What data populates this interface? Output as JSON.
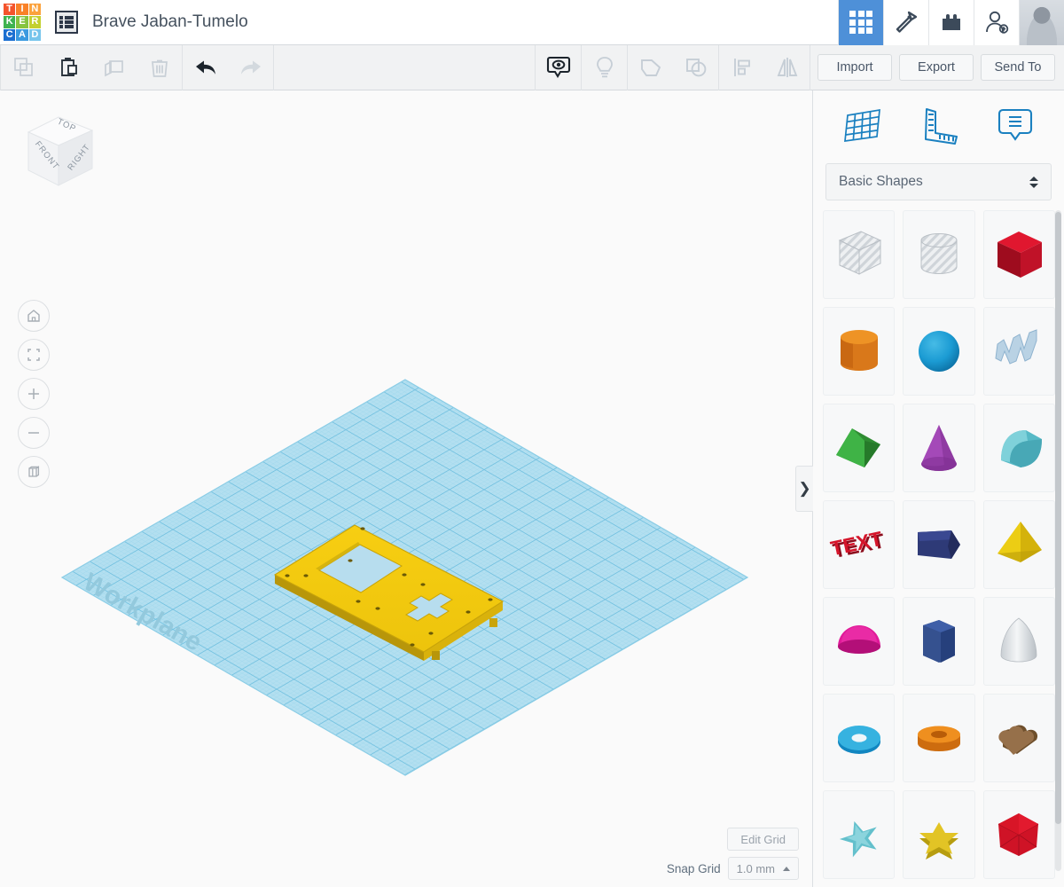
{
  "app": {
    "name": "Tinkercad",
    "logo_letters": [
      {
        "ch": "T",
        "color": "#f4542c"
      },
      {
        "ch": "I",
        "color": "#f98128"
      },
      {
        "ch": "N",
        "color": "#fba23c"
      },
      {
        "ch": "K",
        "color": "#3fb34f"
      },
      {
        "ch": "E",
        "color": "#86c440"
      },
      {
        "ch": "R",
        "color": "#c3d02f"
      },
      {
        "ch": "C",
        "color": "#1b6fd1"
      },
      {
        "ch": "A",
        "color": "#3a9ae0"
      },
      {
        "ch": "D",
        "color": "#77c5ec"
      }
    ]
  },
  "header": {
    "menu_icon": "list-menu-icon",
    "document_title": "Brave Jaban-Tumelo",
    "actions": [
      {
        "name": "gallery-grid-button",
        "icon": "grid-9-icon",
        "active": true
      },
      {
        "name": "codeblocks-button",
        "icon": "hammer-icon",
        "active": false
      },
      {
        "name": "blocks-button",
        "icon": "lego-brick-icon",
        "active": false
      },
      {
        "name": "invite-button",
        "icon": "add-person-icon",
        "active": false
      },
      {
        "name": "profile-avatar",
        "icon": "avatar-photo",
        "active": false
      }
    ]
  },
  "toolbar": {
    "left_tools": [
      {
        "name": "copy-button",
        "icon": "copy-icon",
        "enabled": false
      },
      {
        "name": "paste-button",
        "icon": "paste-clipboard-icon",
        "enabled": true
      },
      {
        "name": "duplicate-button",
        "icon": "duplicate-icon",
        "enabled": false
      },
      {
        "name": "delete-button",
        "icon": "trash-icon",
        "enabled": false
      },
      {
        "name": "undo-button",
        "icon": "undo-arrow-icon",
        "enabled": true
      },
      {
        "name": "redo-button",
        "icon": "redo-arrow-icon",
        "enabled": false
      }
    ],
    "center_tools": [
      {
        "name": "show-hide-button",
        "icon": "eye-bubble-icon",
        "enabled": true
      },
      {
        "name": "light-button",
        "icon": "lightbulb-icon",
        "enabled": false
      },
      {
        "name": "group-button",
        "icon": "group-shapes-icon",
        "enabled": false
      },
      {
        "name": "ungroup-button",
        "icon": "ungroup-shapes-icon",
        "enabled": false
      },
      {
        "name": "align-button",
        "icon": "align-icon",
        "enabled": false
      },
      {
        "name": "mirror-button",
        "icon": "mirror-flip-icon",
        "enabled": false
      }
    ],
    "import_label": "Import",
    "export_label": "Export",
    "send_to_label": "Send To"
  },
  "canvas": {
    "viewcube": {
      "top_label": "TOP",
      "front_label": "FRONT",
      "right_label": "RIGHT"
    },
    "nav_buttons": [
      {
        "name": "home-view-button",
        "icon": "home-icon"
      },
      {
        "name": "fit-view-button",
        "icon": "fit-frame-icon"
      },
      {
        "name": "zoom-in-button",
        "icon": "plus-icon",
        "label": "+"
      },
      {
        "name": "zoom-out-button",
        "icon": "minus-icon",
        "label": "−"
      },
      {
        "name": "ortho-perspective-button",
        "icon": "box-perspective-icon"
      }
    ],
    "workplane_label": "Workplane",
    "workplane_color": "#aadced",
    "object": {
      "name": "yellow-mount-plate",
      "color": "#f2c50f",
      "features": [
        "rectangular-cutout",
        "cross-cutout",
        "screw-holes"
      ]
    },
    "edit_grid_label": "Edit Grid",
    "snap_grid_label": "Snap Grid",
    "snap_grid_value": "1.0 mm",
    "collapse_handle": "❯"
  },
  "right_panel": {
    "tabs": [
      {
        "name": "workplane-tool",
        "icon": "workplane-grid-icon"
      },
      {
        "name": "ruler-tool",
        "icon": "ruler-icon"
      },
      {
        "name": "notes-tool",
        "icon": "note-bubble-icon"
      }
    ],
    "category_label": "Basic Shapes",
    "shapes": [
      {
        "name": "shape-box-hole",
        "label": "Box (hole)",
        "icon": "striped-box-icon",
        "color": "#cfd4d8"
      },
      {
        "name": "shape-cylinder-hole",
        "label": "Cylinder (hole)",
        "icon": "striped-cylinder-icon",
        "color": "#cfd4d8"
      },
      {
        "name": "shape-box",
        "label": "Box",
        "icon": "red-box-icon",
        "color": "#c8102e"
      },
      {
        "name": "shape-cylinder",
        "label": "Cylinder",
        "icon": "orange-cylinder-icon",
        "color": "#e07c16"
      },
      {
        "name": "shape-sphere",
        "label": "Sphere",
        "icon": "blue-sphere-icon",
        "color": "#1f9bd1"
      },
      {
        "name": "shape-scribble",
        "label": "Scribble",
        "icon": "scribble-icon",
        "color": "#b2cde0"
      },
      {
        "name": "shape-roof",
        "label": "Roof",
        "icon": "green-wedge-icon",
        "color": "#3aa93a"
      },
      {
        "name": "shape-cone",
        "label": "Cone",
        "icon": "purple-cone-icon",
        "color": "#8d3a9e"
      },
      {
        "name": "shape-round-roof",
        "label": "Round Roof",
        "icon": "teal-half-cylinder-icon",
        "color": "#4fb6c4"
      },
      {
        "name": "shape-text",
        "label": "Text",
        "icon": "red-text-icon",
        "color": "#cf1b2b"
      },
      {
        "name": "shape-polygon-slab",
        "label": "Polygon",
        "icon": "navy-slab-icon",
        "color": "#2e3a77"
      },
      {
        "name": "shape-pyramid",
        "label": "Pyramid",
        "icon": "yellow-pyramid-icon",
        "color": "#e8c413"
      },
      {
        "name": "shape-dome",
        "label": "Dome",
        "icon": "magenta-dome-icon",
        "color": "#d6128d"
      },
      {
        "name": "shape-hex-prism",
        "label": "Hexagon",
        "icon": "blue-hex-prism-icon",
        "color": "#2f4b8f"
      },
      {
        "name": "shape-paraboloid",
        "label": "Paraboloid",
        "icon": "white-paraboloid-icon",
        "color": "#d9dcdf"
      },
      {
        "name": "shape-torus",
        "label": "Torus",
        "icon": "blue-torus-icon",
        "color": "#1f9bd1"
      },
      {
        "name": "shape-tube",
        "label": "Tube",
        "icon": "orange-tube-icon",
        "color": "#e07c16"
      },
      {
        "name": "shape-heart",
        "label": "Heart",
        "icon": "brown-heart-icon",
        "color": "#8a6642"
      },
      {
        "name": "shape-flat-star",
        "label": "Star (flat)",
        "icon": "teal-star-icon",
        "color": "#4fb6c4"
      },
      {
        "name": "shape-star",
        "label": "Star",
        "icon": "yellow-star-icon",
        "color": "#d9c02a"
      },
      {
        "name": "shape-polyhedron",
        "label": "Polyhedron",
        "icon": "red-polyhedron-icon",
        "color": "#c8102e"
      }
    ]
  }
}
